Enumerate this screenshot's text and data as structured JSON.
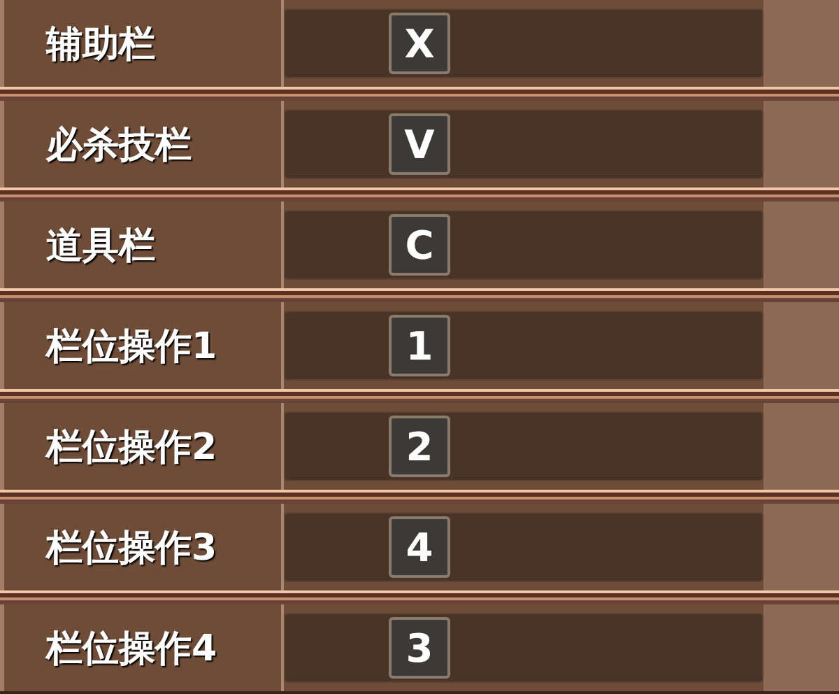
{
  "bindings": [
    {
      "label": "辅助栏",
      "key": "X"
    },
    {
      "label": "必杀技栏",
      "key": "V"
    },
    {
      "label": "道具栏",
      "key": "C"
    },
    {
      "label": "栏位操作1",
      "key": "1"
    },
    {
      "label": "栏位操作2",
      "key": "2"
    },
    {
      "label": "栏位操作3",
      "key": "4"
    },
    {
      "label": "栏位操作4",
      "key": "3"
    }
  ]
}
